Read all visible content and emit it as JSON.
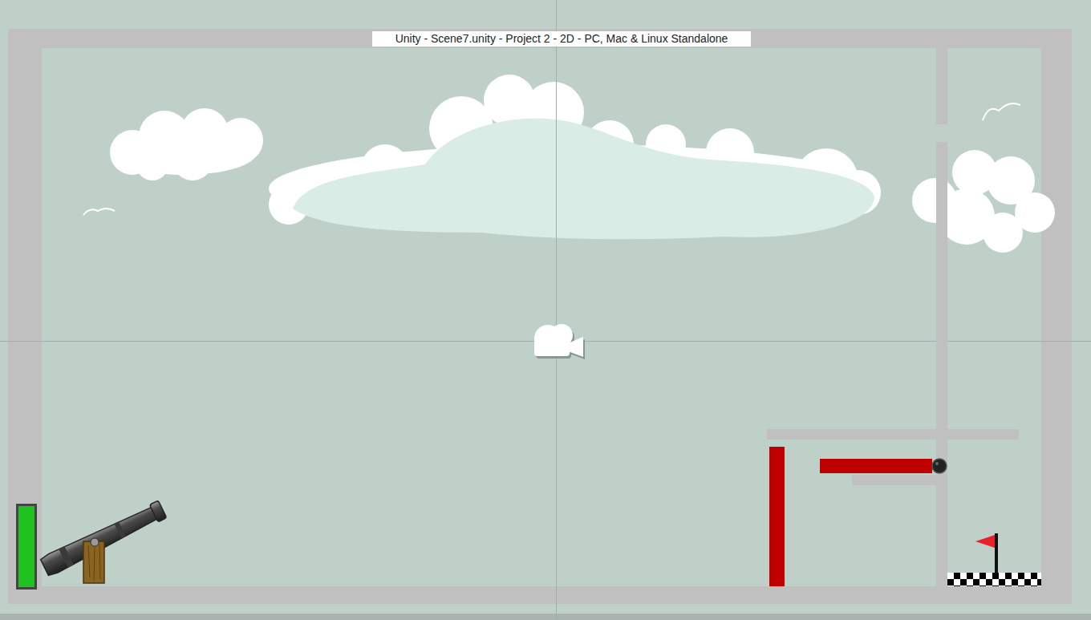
{
  "window": {
    "title": "Unity - Scene7.unity - Project 2 - 2D - PC, Mac & Linux Standalone"
  },
  "power_meter": {
    "level": 1
  }
}
